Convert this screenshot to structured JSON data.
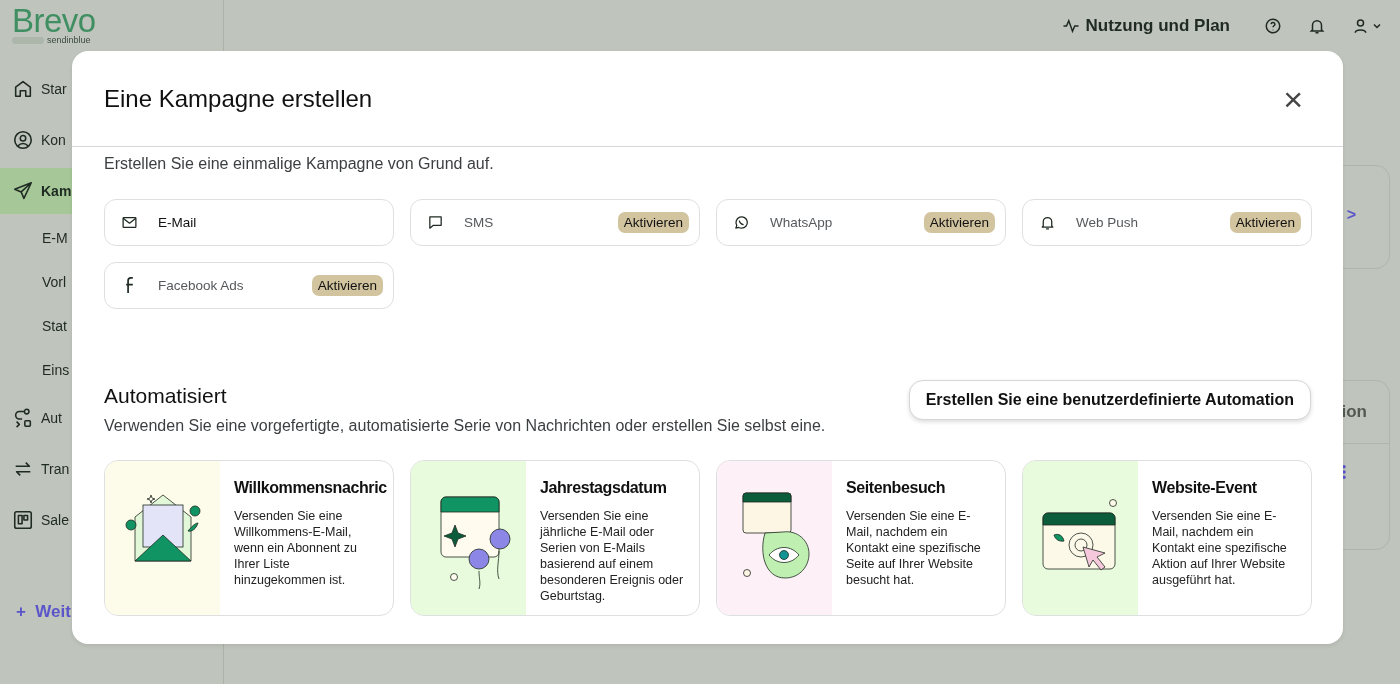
{
  "brand": {
    "name": "Brevo",
    "sub": "sendinblue"
  },
  "sidebar": {
    "items": [
      {
        "kind": "home",
        "label": "Star",
        "selected": false
      },
      {
        "kind": "contact",
        "label": "Kon",
        "selected": false
      },
      {
        "kind": "send",
        "label": "Kam",
        "selected": true
      },
      {
        "kind": "sub",
        "label": "E-M",
        "selected": false
      },
      {
        "kind": "sub",
        "label": "Vorl",
        "selected": false
      },
      {
        "kind": "sub",
        "label": "Stat",
        "selected": false
      },
      {
        "kind": "sub",
        "label": "Eins",
        "selected": false
      },
      {
        "kind": "auto",
        "label": "Aut",
        "selected": false
      },
      {
        "kind": "swap",
        "label": "Tran",
        "selected": false
      },
      {
        "kind": "board",
        "label": "Sale",
        "selected": false
      }
    ],
    "more": {
      "icon": "+",
      "label": "Weit"
    }
  },
  "topbar": {
    "usage": "Nutzung und Plan"
  },
  "background": {
    "card_text": "ion",
    "chevron": ">"
  },
  "modal": {
    "title": "Eine Kampagne erstellen",
    "close": "×",
    "intro": "Erstellen Sie eine einmalige Kampagne von Grund auf.",
    "channels": [
      {
        "kind": "mail",
        "label": "E-Mail",
        "enabled": true
      },
      {
        "kind": "sms",
        "label": "SMS",
        "enabled": false,
        "badge": "Aktivieren"
      },
      {
        "kind": "whatsapp",
        "label": "WhatsApp",
        "enabled": false,
        "badge": "Aktivieren"
      },
      {
        "kind": "push",
        "label": "Web Push",
        "enabled": false,
        "badge": "Aktivieren"
      },
      {
        "kind": "facebook",
        "label": "Facebook Ads",
        "enabled": false,
        "badge": "Aktivieren"
      }
    ],
    "automation": {
      "title": "Automatisiert",
      "description": "Verwenden Sie eine vorgefertigte, automatisierte Serie von Nachrichten oder erstellen Sie selbst eine.",
      "button": "Erstellen Sie eine benutzerdefinierte Automation",
      "cards": [
        {
          "kind": "welcome",
          "title": "Willkommensnachric",
          "text": "Versenden Sie eine Willkommens-E-Mail, wenn ein Abonnent zu Ihrer Liste hinzugekommen ist."
        },
        {
          "kind": "anniversary",
          "title": "Jahrestagsdatum",
          "text": "Versenden Sie eine jährliche E-Mail oder Serien von E-Mails basierend auf einem besonderen Ereignis oder Geburtstag."
        },
        {
          "kind": "page-visit",
          "title": "Seitenbesuch",
          "text": "Versenden Sie eine E-Mail, nachdem ein Kontakt eine spezifische Seite auf Ihrer Website besucht hat."
        },
        {
          "kind": "website-event",
          "title": "Website-Event",
          "text": "Versenden Sie eine E-Mail, nachdem ein Kontakt eine spezifische Aktion auf Ihrer Website ausgeführt hat."
        }
      ]
    }
  }
}
